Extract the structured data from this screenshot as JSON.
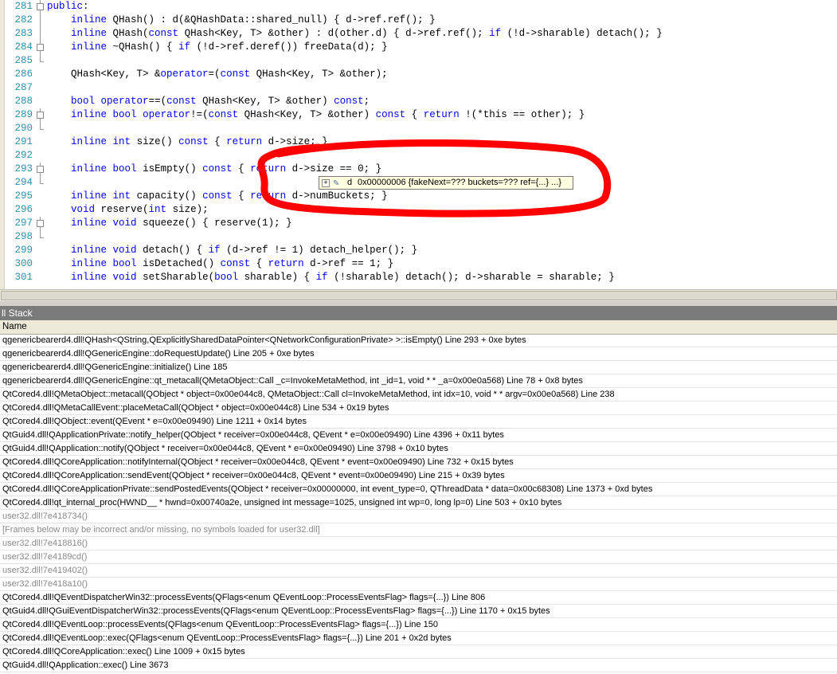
{
  "editor": {
    "lines": [
      {
        "num": "281",
        "text": "public:",
        "fold": "box"
      },
      {
        "num": "282",
        "text": "    inline QHash() : d(&QHashData::shared_null) { d->ref.ref(); }",
        "fold": "line"
      },
      {
        "num": "283",
        "text": "    inline QHash(const QHash<Key, T> &other) : d(other.d) { d->ref.ref(); if (!d->sharable) detach(); }",
        "fold": "line"
      },
      {
        "num": "284",
        "text": "    inline ~QHash() { if (!d->ref.deref()) freeData(d); }",
        "fold": "box"
      },
      {
        "num": "285",
        "text": "",
        "fold": "end"
      },
      {
        "num": "286",
        "text": "    QHash<Key, T> &operator=(const QHash<Key, T> &other);",
        "fold": "none"
      },
      {
        "num": "287",
        "text": "",
        "fold": "none"
      },
      {
        "num": "288",
        "text": "    bool operator==(const QHash<Key, T> &other) const;",
        "fold": "none"
      },
      {
        "num": "289",
        "text": "    inline bool operator!=(const QHash<Key, T> &other) const { return !(*this == other); }",
        "fold": "box"
      },
      {
        "num": "290",
        "text": "",
        "fold": "end"
      },
      {
        "num": "291",
        "text": "    inline int size() const { return d->size; }",
        "fold": "none"
      },
      {
        "num": "292",
        "text": "",
        "fold": "none"
      },
      {
        "num": "293",
        "text": "    inline bool isEmpty() const { return d->size == 0; }",
        "fold": "box"
      },
      {
        "num": "294",
        "text": "",
        "fold": "end"
      },
      {
        "num": "295",
        "text": "    inline int capacity() const { return d->numBuckets; }",
        "fold": "none"
      },
      {
        "num": "296",
        "text": "    void reserve(int size);",
        "fold": "none"
      },
      {
        "num": "297",
        "text": "    inline void squeeze() { reserve(1); }",
        "fold": "box"
      },
      {
        "num": "298",
        "text": "",
        "fold": "end"
      },
      {
        "num": "299",
        "text": "    inline void detach() { if (d->ref != 1) detach_helper(); }",
        "fold": "none"
      },
      {
        "num": "300",
        "text": "    inline bool isDetached() const { return d->ref == 1; }",
        "fold": "none"
      },
      {
        "num": "301",
        "text": "    inline void setSharable(bool sharable) { if (!sharable) detach(); d->sharable = sharable; }",
        "fold": "none"
      }
    ]
  },
  "tooltip": {
    "expand": "+",
    "name": "d",
    "value": "0x00000006 {fakeNext=??? buckets=??? ref={...} ...}"
  },
  "call_stack": {
    "title": "ll Stack",
    "column_header": "Name",
    "frames": [
      {
        "text": "qgenericbearerd4.dll!QHash<QString,QExplicitlySharedDataPointer<QNetworkConfigurationPrivate> >::isEmpty()  Line 293 + 0xe bytes",
        "dim": false
      },
      {
        "text": "qgenericbearerd4.dll!QGenericEngine::doRequestUpdate()  Line 205 + 0xe bytes",
        "dim": false
      },
      {
        "text": "qgenericbearerd4.dll!QGenericEngine::initialize()  Line 185",
        "dim": false
      },
      {
        "text": "qgenericbearerd4.dll!QGenericEngine::qt_metacall(QMetaObject::Call _c=InvokeMetaMethod, int _id=1, void * * _a=0x00e0a568)  Line 78 + 0x8 bytes",
        "dim": false
      },
      {
        "text": "QtCored4.dll!QMetaObject::metacall(QObject * object=0x00e044c8, QMetaObject::Call cl=InvokeMetaMethod, int idx=10, void * * argv=0x00e0a568)  Line 238",
        "dim": false
      },
      {
        "text": "QtCored4.dll!QMetaCallEvent::placeMetaCall(QObject * object=0x00e044c8)  Line 534 + 0x19 bytes",
        "dim": false
      },
      {
        "text": "QtCored4.dll!QObject::event(QEvent * e=0x00e09490)  Line 1211 + 0x14 bytes",
        "dim": false
      },
      {
        "text": "QtGuid4.dll!QApplicationPrivate::notify_helper(QObject * receiver=0x00e044c8, QEvent * e=0x00e09490)  Line 4396 + 0x11 bytes",
        "dim": false
      },
      {
        "text": "QtGuid4.dll!QApplication::notify(QObject * receiver=0x00e044c8, QEvent * e=0x00e09490)  Line 3798 + 0x10 bytes",
        "dim": false
      },
      {
        "text": "QtCored4.dll!QCoreApplication::notifyInternal(QObject * receiver=0x00e044c8, QEvent * event=0x00e09490)  Line 732 + 0x15 bytes",
        "dim": false
      },
      {
        "text": "QtCored4.dll!QCoreApplication::sendEvent(QObject * receiver=0x00e044c8, QEvent * event=0x00e09490)  Line 215 + 0x39 bytes",
        "dim": false
      },
      {
        "text": "QtCored4.dll!QCoreApplicationPrivate::sendPostedEvents(QObject * receiver=0x00000000, int event_type=0, QThreadData * data=0x00c68308)  Line 1373 + 0xd bytes",
        "dim": false
      },
      {
        "text": "QtCored4.dll!qt_internal_proc(HWND__ * hwnd=0x00740a2e, unsigned int message=1025, unsigned int wp=0, long lp=0)  Line 503 + 0x10 bytes",
        "dim": false
      },
      {
        "text": "user32.dll!7e418734()",
        "dim": true
      },
      {
        "text": "[Frames below may be incorrect and/or missing, no symbols loaded for user32.dll]",
        "dim": true
      },
      {
        "text": "user32.dll!7e418816()",
        "dim": true
      },
      {
        "text": "user32.dll!7e4189cd()",
        "dim": true
      },
      {
        "text": "user32.dll!7e419402()",
        "dim": true
      },
      {
        "text": "user32.dll!7e418a10()",
        "dim": true
      },
      {
        "text": "QtCored4.dll!QEventDispatcherWin32::processEvents(QFlags<enum QEventLoop::ProcessEventsFlag> flags={...})  Line 806",
        "dim": false
      },
      {
        "text": "QtGuid4.dll!QGuiEventDispatcherWin32::processEvents(QFlags<enum QEventLoop::ProcessEventsFlag> flags={...})  Line 1170 + 0x15 bytes",
        "dim": false
      },
      {
        "text": "QtCored4.dll!QEventLoop::processEvents(QFlags<enum QEventLoop::ProcessEventsFlag> flags={...})  Line 150",
        "dim": false
      },
      {
        "text": "QtCored4.dll!QEventLoop::exec(QFlags<enum QEventLoop::ProcessEventsFlag> flags={...})  Line 201 + 0x2d bytes",
        "dim": false
      },
      {
        "text": "QtCored4.dll!QCoreApplication::exec()  Line 1009 + 0x15 bytes",
        "dim": false
      },
      {
        "text": "QtGuid4.dll!QApplication::exec()  Line 3673",
        "dim": false
      }
    ]
  },
  "colors": {
    "line_number": "#2b91af",
    "keyword": "#0000ff",
    "annotation": "#ff0000",
    "tooltip_bg": "#ffffe1"
  }
}
